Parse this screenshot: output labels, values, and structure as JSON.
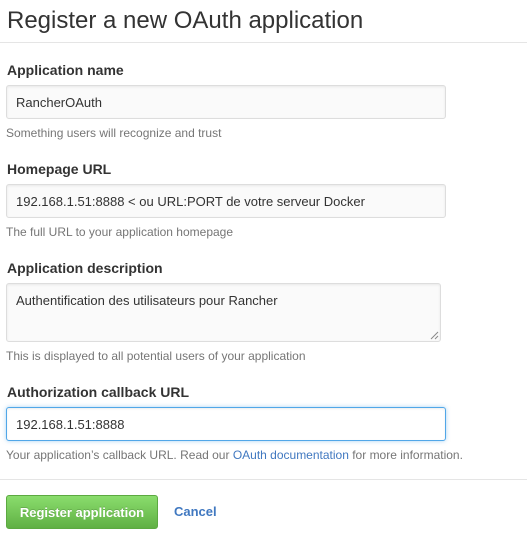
{
  "page": {
    "title": "Register a new OAuth application"
  },
  "form": {
    "app_name": {
      "label": "Application name",
      "value": "RancherOAuth",
      "help": "Something users will recognize and trust"
    },
    "homepage": {
      "label": "Homepage URL",
      "value": "192.168.1.51:8888 < ou URL:PORT de votre serveur Docker",
      "help": "The full URL to your application homepage"
    },
    "description": {
      "label": "Application description",
      "value": "Authentification des utilisateurs pour Rancher",
      "help": "This is displayed to all potential users of your application"
    },
    "callback": {
      "label": "Authorization callback URL",
      "value": "192.168.1.51:8888",
      "help_prefix": "Your application’s callback URL. Read our ",
      "help_link": "OAuth documentation",
      "help_suffix": " for more information."
    }
  },
  "actions": {
    "register_label": "Register application",
    "cancel_label": "Cancel"
  },
  "colors": {
    "link": "#4078c0",
    "button_green_top": "#8add6d",
    "button_green_bottom": "#60b044",
    "focus_border": "#51a7e8",
    "muted_text": "#767676"
  }
}
